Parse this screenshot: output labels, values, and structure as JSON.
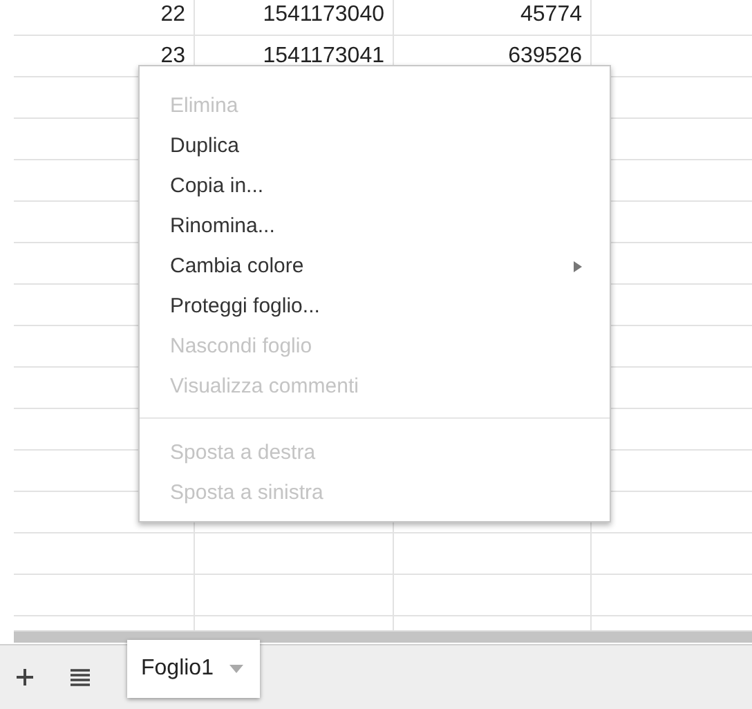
{
  "table": {
    "rows": [
      {
        "cells": [
          "22",
          "1541173040",
          "45774"
        ]
      },
      {
        "cells": [
          "23",
          "1541173041",
          "639526"
        ]
      }
    ]
  },
  "context_menu": {
    "items": [
      {
        "kind": "item",
        "label": "Elimina",
        "disabled": true
      },
      {
        "kind": "item",
        "label": "Duplica",
        "disabled": false
      },
      {
        "kind": "item",
        "label": "Copia in...",
        "disabled": false
      },
      {
        "kind": "item",
        "label": "Rinomina...",
        "disabled": false
      },
      {
        "kind": "item",
        "label": "Cambia colore",
        "disabled": false,
        "submenu": true
      },
      {
        "kind": "item",
        "label": "Proteggi foglio...",
        "disabled": false
      },
      {
        "kind": "item",
        "label": "Nascondi foglio",
        "disabled": true
      },
      {
        "kind": "item",
        "label": "Visualizza commenti",
        "disabled": true
      },
      {
        "kind": "separator"
      },
      {
        "kind": "item",
        "label": "Sposta a destra",
        "disabled": true
      },
      {
        "kind": "item",
        "label": "Sposta a sinistra",
        "disabled": true
      }
    ]
  },
  "sheet_bar": {
    "tabs": [
      {
        "label": "Foglio1",
        "selected": true
      }
    ]
  }
}
